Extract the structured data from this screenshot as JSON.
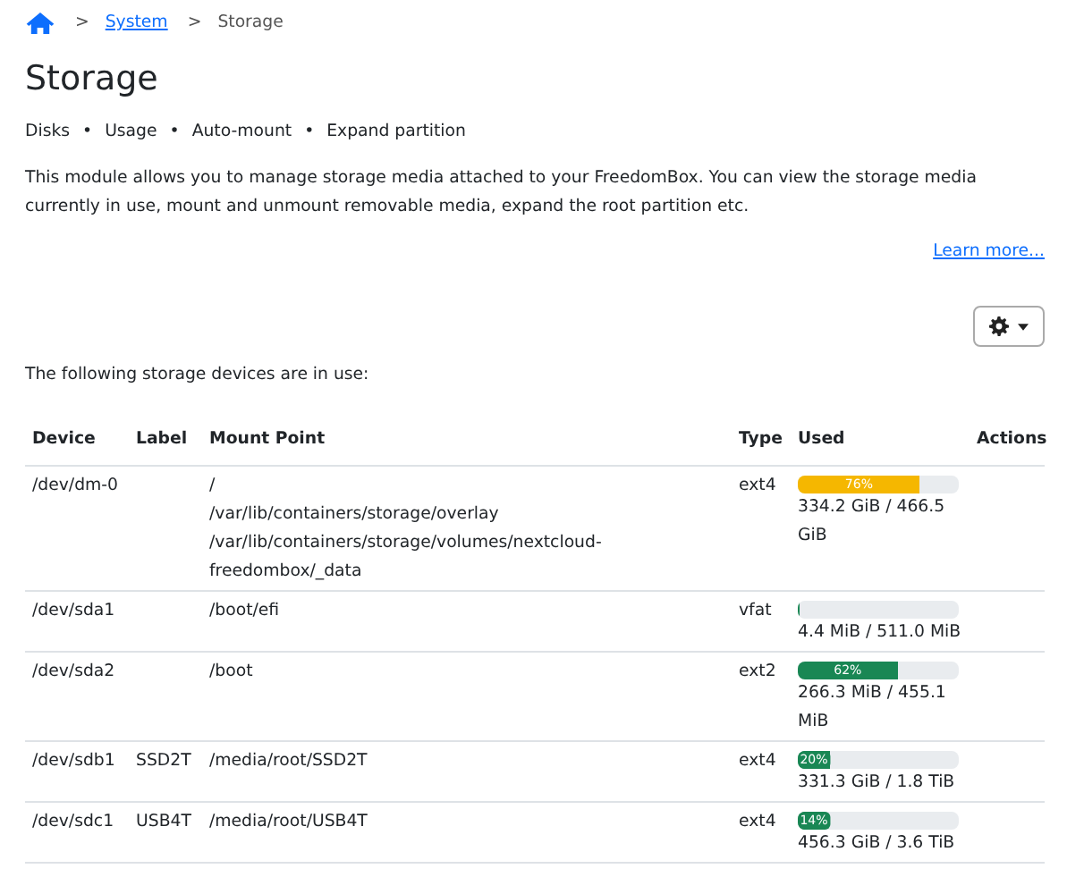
{
  "breadcrumb": {
    "items": [
      "System",
      "Storage"
    ],
    "separator": ">"
  },
  "title": "Storage",
  "nav": [
    "Disks",
    "Usage",
    "Auto-mount",
    "Expand partition"
  ],
  "nav_separator": "•",
  "description": "This module allows you to manage storage media attached to your FreedomBox. You can view the storage media currently in use, mount and unmount removable media, expand the root partition etc.",
  "learn_more": "Learn more...",
  "intro": "The following storage devices are in use:",
  "table": {
    "columns": [
      "Device",
      "Label",
      "Mount Point",
      "Type",
      "Used",
      "Actions"
    ],
    "rows": [
      {
        "device": "/dev/dm-0",
        "label": "",
        "mount_points": [
          "/",
          "/var/lib/containers/storage/overlay",
          "/var/lib/containers/storage/volumes/nextcloud-freedombox/_data"
        ],
        "type": "ext4",
        "level": 0.76,
        "percent": "76%",
        "color": "#f5b700",
        "used": "334.2 GiB / 466.5 GiB"
      },
      {
        "device": "/dev/sda1",
        "mount_points": [
          "/boot/efi"
        ],
        "type": "vfat",
        "level": 0.01,
        "percent": "",
        "color": "#198754",
        "used": "4.4 MiB / 511.0 MiB"
      },
      {
        "device": "/dev/sda2",
        "mount_points": [
          "/boot"
        ],
        "type": "ext2",
        "level": 0.62,
        "percent": "62%",
        "color": "#198754",
        "used": "266.3 MiB / 455.1 MiB"
      },
      {
        "device": "/dev/sdb1",
        "label": "SSD2T",
        "mount_points": [
          "/media/root/SSD2T"
        ],
        "type": "ext4",
        "level": 0.2,
        "percent": "20%",
        "color": "#198754",
        "used": "331.3 GiB / 1.8 TiB"
      },
      {
        "device": "/dev/sdc1",
        "label": "USB4T",
        "mount_points": [
          "/media/root/USB4T"
        ],
        "type": "ext4",
        "level": 0.14,
        "percent": "14%",
        "color": "#198754",
        "used": "456.3 GiB / 3.6 TiB"
      }
    ]
  }
}
